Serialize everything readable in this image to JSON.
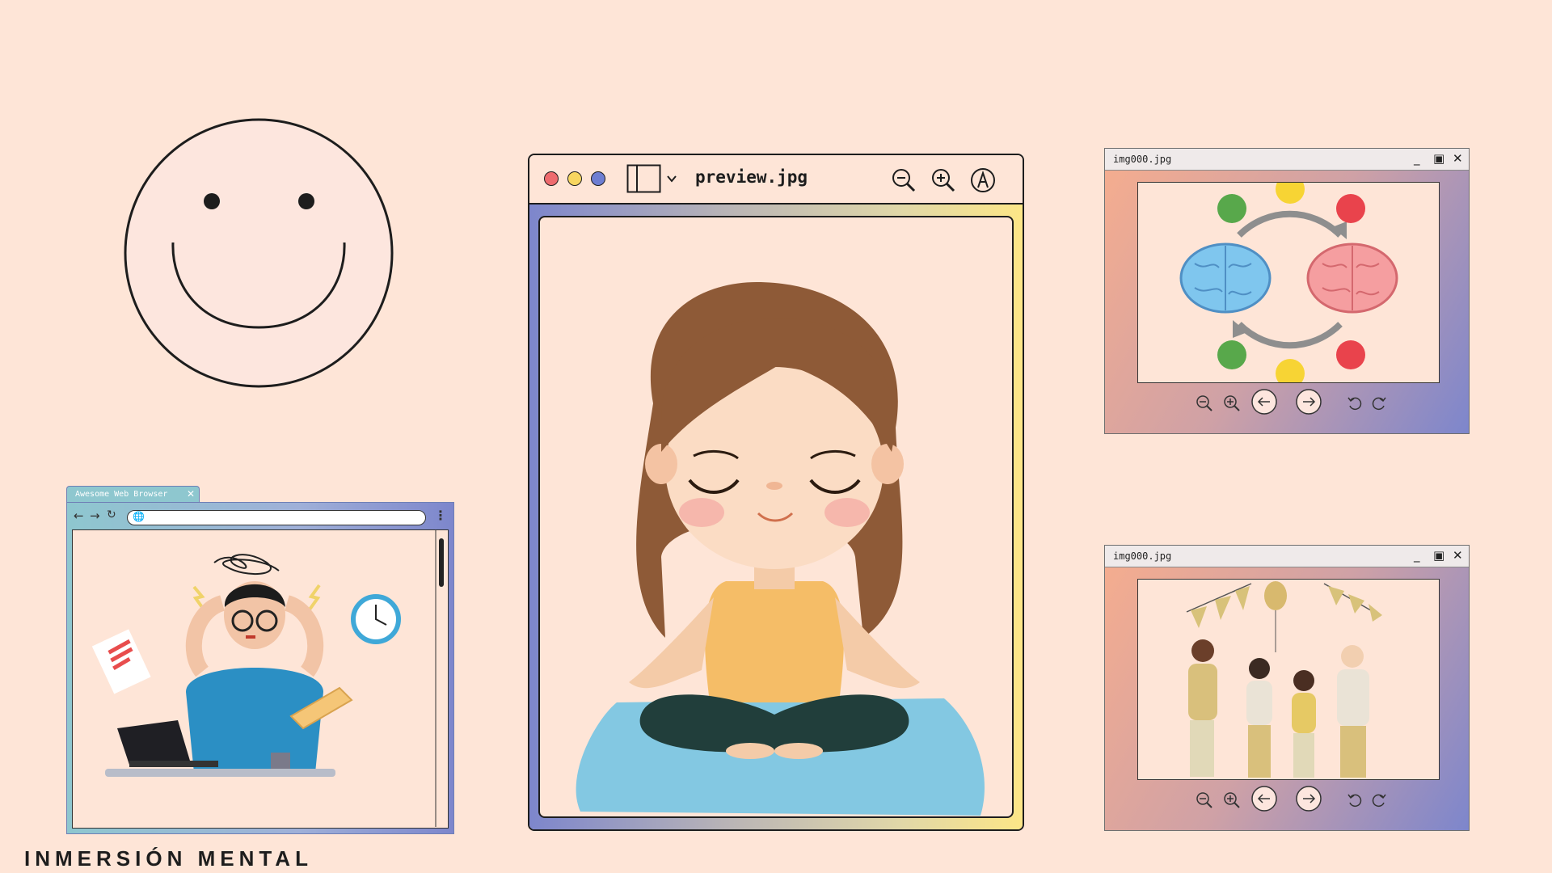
{
  "preview_window": {
    "title": "preview.jpg",
    "traffic_colors": [
      "#ee6b6e",
      "#f7d660",
      "#6e7ed2"
    ]
  },
  "viewer_top": {
    "title": "img000.jpg"
  },
  "viewer_bottom": {
    "title": "img000.jpg"
  },
  "browser": {
    "tab_title": "Awesome Web Browser",
    "url": ""
  },
  "caption": "INMERSIÓN MENTAL",
  "icons": {
    "window_controls": [
      "minimize-icon",
      "maximize-icon",
      "close-icon"
    ],
    "viewer_toolbar": [
      "zoom-out-icon",
      "zoom-in-icon",
      "arrow-left-icon",
      "arrow-right-icon",
      "rotate-left-icon",
      "rotate-right-icon"
    ]
  }
}
